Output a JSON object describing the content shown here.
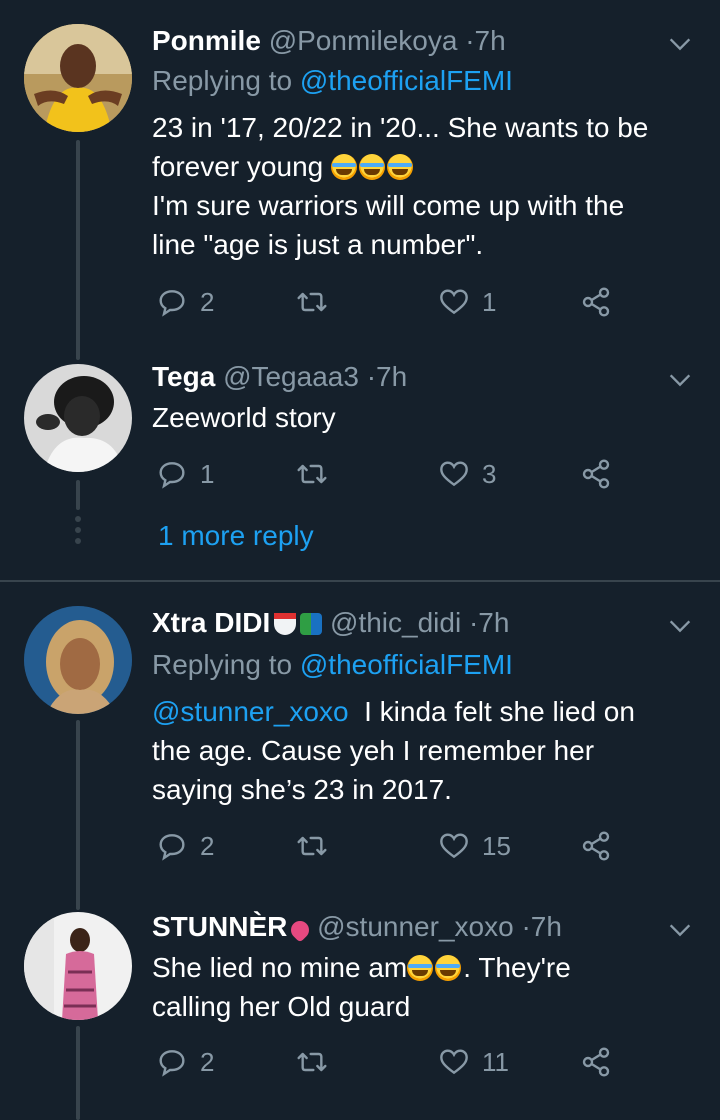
{
  "colors": {
    "background": "#15202b",
    "text": "#ffffff",
    "muted": "#8899a6",
    "accent": "#1da1f2",
    "divider": "#38444d"
  },
  "tweets": [
    {
      "name": "Ponmile",
      "handle": "@Ponmilekoya",
      "time": "7h",
      "replying_prefix": "Replying to",
      "replying_to": "@theofficialFEMI",
      "line1": "23 in '17, 20/22 in '20... She wants to be",
      "line2": "forever young",
      "line3": "I'm sure warriors will come up with the",
      "line4": "line \"age is just a number\".",
      "replies": "2",
      "likes": "1",
      "emoji": "rolling-on-the-floor-laughing"
    },
    {
      "name": "Tega",
      "handle": "@Tegaaa3",
      "time": "7h",
      "line1": "Zeeworld story",
      "replies": "1",
      "likes": "3",
      "more_replies": "1 more reply"
    },
    {
      "name": "Xtra DIDI",
      "handle": "@thic_didi",
      "time": "7h",
      "replying_prefix": "Replying to",
      "replying_to": "@theofficialFEMI",
      "mention": "@stunner_xoxo",
      "line1": "I kinda felt she lied on",
      "line2": "the age. Cause yeh I remember her",
      "line3": "saying she’s 23 in 2017.",
      "replies": "2",
      "likes": "15",
      "name_emoji": [
        "noodle-bowl",
        "books"
      ]
    },
    {
      "name": "STUNNÈR",
      "handle": "@stunner_xoxo",
      "time": "7h",
      "line1a": "She lied no mine am",
      "line1b": ". They're",
      "line2": "calling her Old guard",
      "replies": "2",
      "likes": "11",
      "name_emoji": [
        "sparkling-heart"
      ],
      "emoji": "face-with-tears-of-joy"
    }
  ]
}
